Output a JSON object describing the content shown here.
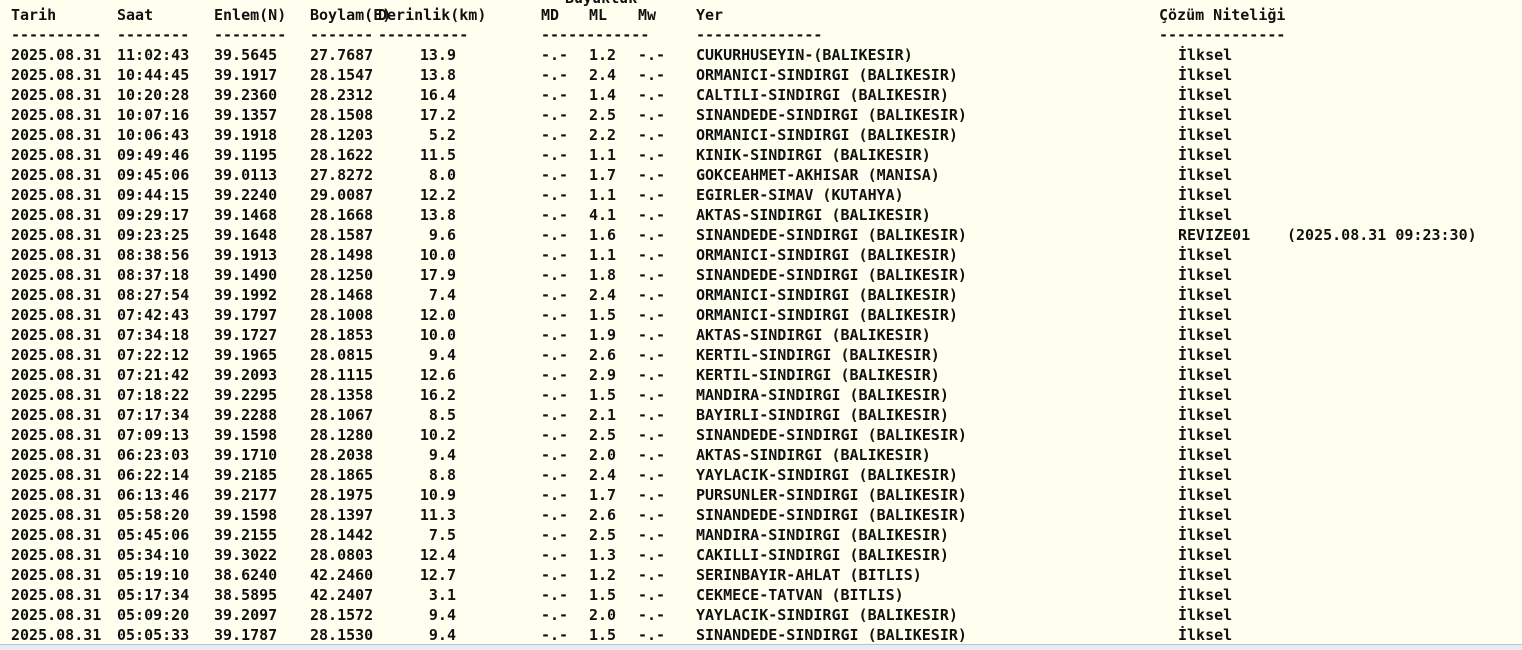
{
  "header": {
    "tarih": "Tarih",
    "saat": "Saat",
    "enlem": "Enlem(N)",
    "boylam": "Boylam(E)",
    "derinlik": "Derinlik(km)",
    "buyukluk": "Büyüklük",
    "md": "MD",
    "ml": "ML",
    "mw": "Mw",
    "yer": "Yer",
    "cozum": "Çözüm Niteliği"
  },
  "dashes": {
    "tarih": "----------",
    "saat": "--------",
    "enlem": "--------",
    "boylam": "-------",
    "derinlik": "----------",
    "buyukluk": "------------",
    "yer": "--------------",
    "cozum": "--------------"
  },
  "rows": [
    {
      "tarih": "2025.08.31",
      "saat": "11:02:43",
      "enlem": "39.5645",
      "boylam": "27.7687",
      "derinlik": "13.9",
      "md": "-.-",
      "ml": "1.2",
      "mw": "-.-",
      "yer": "CUKURHUSEYIN-(BALIKESIR)",
      "cozum": "İlksel",
      "revize": ""
    },
    {
      "tarih": "2025.08.31",
      "saat": "10:44:45",
      "enlem": "39.1917",
      "boylam": "28.1547",
      "derinlik": "13.8",
      "md": "-.-",
      "ml": "2.4",
      "mw": "-.-",
      "yer": "ORMANICI-SINDIRGI (BALIKESIR)",
      "cozum": "İlksel",
      "revize": ""
    },
    {
      "tarih": "2025.08.31",
      "saat": "10:20:28",
      "enlem": "39.2360",
      "boylam": "28.2312",
      "derinlik": "16.4",
      "md": "-.-",
      "ml": "1.4",
      "mw": "-.-",
      "yer": "CALTILI-SINDIRGI (BALIKESIR)",
      "cozum": "İlksel",
      "revize": ""
    },
    {
      "tarih": "2025.08.31",
      "saat": "10:07:16",
      "enlem": "39.1357",
      "boylam": "28.1508",
      "derinlik": "17.2",
      "md": "-.-",
      "ml": "2.5",
      "mw": "-.-",
      "yer": "SINANDEDE-SINDIRGI (BALIKESIR)",
      "cozum": "İlksel",
      "revize": ""
    },
    {
      "tarih": "2025.08.31",
      "saat": "10:06:43",
      "enlem": "39.1918",
      "boylam": "28.1203",
      "derinlik": "5.2",
      "md": "-.-",
      "ml": "2.2",
      "mw": "-.-",
      "yer": "ORMANICI-SINDIRGI (BALIKESIR)",
      "cozum": "İlksel",
      "revize": ""
    },
    {
      "tarih": "2025.08.31",
      "saat": "09:49:46",
      "enlem": "39.1195",
      "boylam": "28.1622",
      "derinlik": "11.5",
      "md": "-.-",
      "ml": "1.1",
      "mw": "-.-",
      "yer": "KINIK-SINDIRGI (BALIKESIR)",
      "cozum": "İlksel",
      "revize": ""
    },
    {
      "tarih": "2025.08.31",
      "saat": "09:45:06",
      "enlem": "39.0113",
      "boylam": "27.8272",
      "derinlik": "8.0",
      "md": "-.-",
      "ml": "1.7",
      "mw": "-.-",
      "yer": "GOKCEAHMET-AKHISAR (MANISA)",
      "cozum": "İlksel",
      "revize": ""
    },
    {
      "tarih": "2025.08.31",
      "saat": "09:44:15",
      "enlem": "39.2240",
      "boylam": "29.0087",
      "derinlik": "12.2",
      "md": "-.-",
      "ml": "1.1",
      "mw": "-.-",
      "yer": "EGIRLER-SIMAV (KUTAHYA)",
      "cozum": "İlksel",
      "revize": ""
    },
    {
      "tarih": "2025.08.31",
      "saat": "09:29:17",
      "enlem": "39.1468",
      "boylam": "28.1668",
      "derinlik": "13.8",
      "md": "-.-",
      "ml": "4.1",
      "mw": "-.-",
      "yer": "AKTAS-SINDIRGI (BALIKESIR)",
      "cozum": "İlksel",
      "revize": ""
    },
    {
      "tarih": "2025.08.31",
      "saat": "09:23:25",
      "enlem": "39.1648",
      "boylam": "28.1587",
      "derinlik": "9.6",
      "md": "-.-",
      "ml": "1.6",
      "mw": "-.-",
      "yer": "SINANDEDE-SINDIRGI (BALIKESIR)",
      "cozum": "REVIZE01",
      "revize": "(2025.08.31 09:23:30)"
    },
    {
      "tarih": "2025.08.31",
      "saat": "08:38:56",
      "enlem": "39.1913",
      "boylam": "28.1498",
      "derinlik": "10.0",
      "md": "-.-",
      "ml": "1.1",
      "mw": "-.-",
      "yer": "ORMANICI-SINDIRGI (BALIKESIR)",
      "cozum": "İlksel",
      "revize": ""
    },
    {
      "tarih": "2025.08.31",
      "saat": "08:37:18",
      "enlem": "39.1490",
      "boylam": "28.1250",
      "derinlik": "17.9",
      "md": "-.-",
      "ml": "1.8",
      "mw": "-.-",
      "yer": "SINANDEDE-SINDIRGI (BALIKESIR)",
      "cozum": "İlksel",
      "revize": ""
    },
    {
      "tarih": "2025.08.31",
      "saat": "08:27:54",
      "enlem": "39.1992",
      "boylam": "28.1468",
      "derinlik": "7.4",
      "md": "-.-",
      "ml": "2.4",
      "mw": "-.-",
      "yer": "ORMANICI-SINDIRGI (BALIKESIR)",
      "cozum": "İlksel",
      "revize": ""
    },
    {
      "tarih": "2025.08.31",
      "saat": "07:42:43",
      "enlem": "39.1797",
      "boylam": "28.1008",
      "derinlik": "12.0",
      "md": "-.-",
      "ml": "1.5",
      "mw": "-.-",
      "yer": "ORMANICI-SINDIRGI (BALIKESIR)",
      "cozum": "İlksel",
      "revize": ""
    },
    {
      "tarih": "2025.08.31",
      "saat": "07:34:18",
      "enlem": "39.1727",
      "boylam": "28.1853",
      "derinlik": "10.0",
      "md": "-.-",
      "ml": "1.9",
      "mw": "-.-",
      "yer": "AKTAS-SINDIRGI (BALIKESIR)",
      "cozum": "İlksel",
      "revize": ""
    },
    {
      "tarih": "2025.08.31",
      "saat": "07:22:12",
      "enlem": "39.1965",
      "boylam": "28.0815",
      "derinlik": "9.4",
      "md": "-.-",
      "ml": "2.6",
      "mw": "-.-",
      "yer": "KERTIL-SINDIRGI (BALIKESIR)",
      "cozum": "İlksel",
      "revize": ""
    },
    {
      "tarih": "2025.08.31",
      "saat": "07:21:42",
      "enlem": "39.2093",
      "boylam": "28.1115",
      "derinlik": "12.6",
      "md": "-.-",
      "ml": "2.9",
      "mw": "-.-",
      "yer": "KERTIL-SINDIRGI (BALIKESIR)",
      "cozum": "İlksel",
      "revize": ""
    },
    {
      "tarih": "2025.08.31",
      "saat": "07:18:22",
      "enlem": "39.2295",
      "boylam": "28.1358",
      "derinlik": "16.2",
      "md": "-.-",
      "ml": "1.5",
      "mw": "-.-",
      "yer": "MANDIRA-SINDIRGI (BALIKESIR)",
      "cozum": "İlksel",
      "revize": ""
    },
    {
      "tarih": "2025.08.31",
      "saat": "07:17:34",
      "enlem": "39.2288",
      "boylam": "28.1067",
      "derinlik": "8.5",
      "md": "-.-",
      "ml": "2.1",
      "mw": "-.-",
      "yer": "BAYIRLI-SINDIRGI (BALIKESIR)",
      "cozum": "İlksel",
      "revize": ""
    },
    {
      "tarih": "2025.08.31",
      "saat": "07:09:13",
      "enlem": "39.1598",
      "boylam": "28.1280",
      "derinlik": "10.2",
      "md": "-.-",
      "ml": "2.5",
      "mw": "-.-",
      "yer": "SINANDEDE-SINDIRGI (BALIKESIR)",
      "cozum": "İlksel",
      "revize": ""
    },
    {
      "tarih": "2025.08.31",
      "saat": "06:23:03",
      "enlem": "39.1710",
      "boylam": "28.2038",
      "derinlik": "9.4",
      "md": "-.-",
      "ml": "2.0",
      "mw": "-.-",
      "yer": "AKTAS-SINDIRGI (BALIKESIR)",
      "cozum": "İlksel",
      "revize": ""
    },
    {
      "tarih": "2025.08.31",
      "saat": "06:22:14",
      "enlem": "39.2185",
      "boylam": "28.1865",
      "derinlik": "8.8",
      "md": "-.-",
      "ml": "2.4",
      "mw": "-.-",
      "yer": "YAYLACIK-SINDIRGI (BALIKESIR)",
      "cozum": "İlksel",
      "revize": ""
    },
    {
      "tarih": "2025.08.31",
      "saat": "06:13:46",
      "enlem": "39.2177",
      "boylam": "28.1975",
      "derinlik": "10.9",
      "md": "-.-",
      "ml": "1.7",
      "mw": "-.-",
      "yer": "PURSUNLER-SINDIRGI (BALIKESIR)",
      "cozum": "İlksel",
      "revize": ""
    },
    {
      "tarih": "2025.08.31",
      "saat": "05:58:20",
      "enlem": "39.1598",
      "boylam": "28.1397",
      "derinlik": "11.3",
      "md": "-.-",
      "ml": "2.6",
      "mw": "-.-",
      "yer": "SINANDEDE-SINDIRGI (BALIKESIR)",
      "cozum": "İlksel",
      "revize": ""
    },
    {
      "tarih": "2025.08.31",
      "saat": "05:45:06",
      "enlem": "39.2155",
      "boylam": "28.1442",
      "derinlik": "7.5",
      "md": "-.-",
      "ml": "2.5",
      "mw": "-.-",
      "yer": "MANDIRA-SINDIRGI (BALIKESIR)",
      "cozum": "İlksel",
      "revize": ""
    },
    {
      "tarih": "2025.08.31",
      "saat": "05:34:10",
      "enlem": "39.3022",
      "boylam": "28.0803",
      "derinlik": "12.4",
      "md": "-.-",
      "ml": "1.3",
      "mw": "-.-",
      "yer": "CAKILLI-SINDIRGI (BALIKESIR)",
      "cozum": "İlksel",
      "revize": ""
    },
    {
      "tarih": "2025.08.31",
      "saat": "05:19:10",
      "enlem": "38.6240",
      "boylam": "42.2460",
      "derinlik": "12.7",
      "md": "-.-",
      "ml": "1.2",
      "mw": "-.-",
      "yer": "SERINBAYIR-AHLAT (BITLIS)",
      "cozum": "İlksel",
      "revize": ""
    },
    {
      "tarih": "2025.08.31",
      "saat": "05:17:34",
      "enlem": "38.5895",
      "boylam": "42.2407",
      "derinlik": "3.1",
      "md": "-.-",
      "ml": "1.5",
      "mw": "-.-",
      "yer": "CEKMECE-TATVAN (BITLIS)",
      "cozum": "İlksel",
      "revize": ""
    },
    {
      "tarih": "2025.08.31",
      "saat": "05:09:20",
      "enlem": "39.2097",
      "boylam": "28.1572",
      "derinlik": "9.4",
      "md": "-.-",
      "ml": "2.0",
      "mw": "-.-",
      "yer": "YAYLACIK-SINDIRGI (BALIKESIR)",
      "cozum": "İlksel",
      "revize": ""
    },
    {
      "tarih": "2025.08.31",
      "saat": "05:05:33",
      "enlem": "39.1787",
      "boylam": "28.1530",
      "derinlik": "9.4",
      "md": "-.-",
      "ml": "1.5",
      "mw": "-.-",
      "yer": "SINANDEDE-SINDIRGI (BALIKESIR)",
      "cozum": "İlksel",
      "revize": ""
    }
  ]
}
